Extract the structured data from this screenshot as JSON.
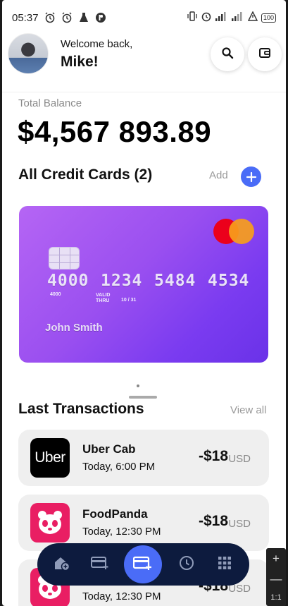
{
  "status_bar": {
    "time": "05:37",
    "battery": "100"
  },
  "header": {
    "welcome": "Welcome back,",
    "name": "Mike!"
  },
  "balance": {
    "label": "Total Balance",
    "value": "$4,567 893.89"
  },
  "cards_section": {
    "title": "All Credit Cards (2)",
    "add_label": "Add"
  },
  "card": {
    "group1": "4000",
    "group2": "1234",
    "group3": "5484",
    "group4": "4534",
    "group_sub": "4000",
    "valid_label_1": "VALID",
    "valid_label_2": "THRU",
    "expiry": "10 / 31",
    "holder": "John Smith"
  },
  "transactions_section": {
    "title": "Last Transactions",
    "view_all": "View all"
  },
  "transactions": [
    {
      "name": "Uber Cab",
      "time": "Today, 6:00 PM",
      "amount": "-$18",
      "currency": "USD",
      "logo_text": "Uber"
    },
    {
      "name": "FoodPanda",
      "time": "Today, 12:30 PM",
      "amount": "-$18",
      "currency": "USD"
    },
    {
      "name": "",
      "time": "Today, 12:30 PM",
      "amount": "-$18",
      "currency": "USD"
    }
  ],
  "zoom_tool": {
    "plus": "+",
    "minus": "—",
    "ratio": "1:1"
  },
  "colors": {
    "accent": "#4a6cf7",
    "nav_bg": "#0d1b3e",
    "card_start": "#b565f4",
    "card_end": "#6a32e8",
    "foodpanda": "#e91e63"
  },
  "icons": {
    "search": "search-icon",
    "wallet": "wallet-icon",
    "add": "plus-icon",
    "nav": [
      "home-add-icon",
      "card-add-icon",
      "card-add-active-icon",
      "clock-icon",
      "grid-icon"
    ]
  }
}
